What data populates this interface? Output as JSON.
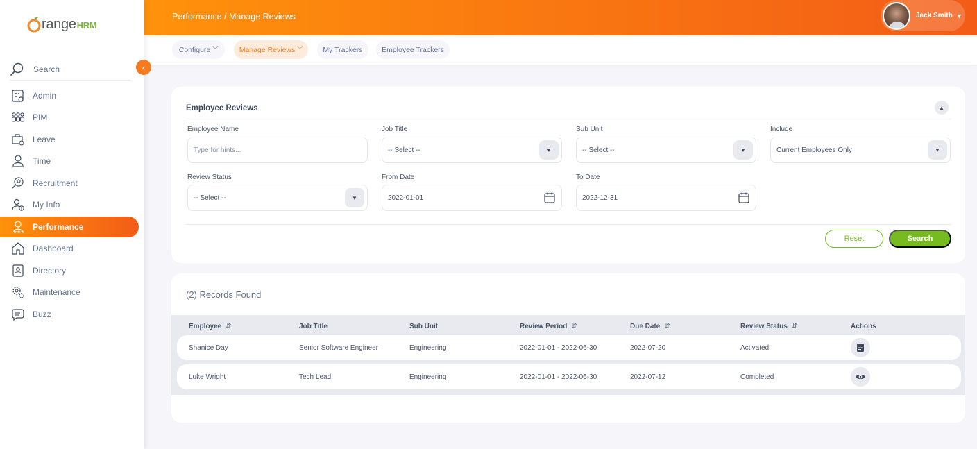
{
  "brand": {
    "o": "O",
    "rest": "range",
    "hrm": "HRM"
  },
  "sidebar": {
    "search_label": "Search",
    "items": [
      {
        "label": "Admin",
        "icon": "admin-icon"
      },
      {
        "label": "PIM",
        "icon": "pim-icon"
      },
      {
        "label": "Leave",
        "icon": "leave-icon"
      },
      {
        "label": "Time",
        "icon": "time-icon"
      },
      {
        "label": "Recruitment",
        "icon": "recruitment-icon"
      },
      {
        "label": "My Info",
        "icon": "my-info-icon"
      },
      {
        "label": "Performance",
        "icon": "performance-icon",
        "active": true
      },
      {
        "label": "Dashboard",
        "icon": "dashboard-icon"
      },
      {
        "label": "Directory",
        "icon": "directory-icon"
      },
      {
        "label": "Maintenance",
        "icon": "maintenance-icon"
      },
      {
        "label": "Buzz",
        "icon": "buzz-icon"
      }
    ]
  },
  "header": {
    "breadcrumb": "Performance / Manage Reviews",
    "user_name": "Jack Smith"
  },
  "subnav": {
    "configure": "Configure",
    "manage_reviews": "Manage Reviews",
    "my_trackers": "My Trackers",
    "employee_trackers": "Employee Trackers"
  },
  "filters": {
    "title": "Employee Reviews",
    "employee_name": {
      "label": "Employee Name",
      "placeholder": "Type for hints..."
    },
    "job_title": {
      "label": "Job Title",
      "value": "-- Select --"
    },
    "sub_unit": {
      "label": "Sub Unit",
      "value": "-- Select --"
    },
    "include": {
      "label": "Include",
      "value": "Current Employees Only"
    },
    "review_status": {
      "label": "Review Status",
      "value": "-- Select --"
    },
    "from_date": {
      "label": "From Date",
      "value": "2022-01-01"
    },
    "to_date": {
      "label": "To Date",
      "value": "2022-12-31"
    },
    "reset_label": "Reset",
    "search_label": "Search"
  },
  "results": {
    "records_found": "(2) Records Found",
    "columns": {
      "employee": "Employee",
      "job_title": "Job Title",
      "sub_unit": "Sub Unit",
      "review_period": "Review Period",
      "due_date": "Due Date",
      "review_status": "Review Status",
      "actions": "Actions"
    },
    "rows": [
      {
        "employee": "Shanice Day",
        "job_title": "Senior Software Engineer",
        "sub_unit": "Engineering",
        "review_period": "2022-01-01 - 2022-06-30",
        "due_date": "2022-07-20",
        "review_status": "Activated",
        "action_icon": "document-icon"
      },
      {
        "employee": "Luke Wright",
        "job_title": "Tech Lead",
        "sub_unit": "Engineering",
        "review_period": "2022-01-01 - 2022-06-30",
        "due_date": "2022-07-12",
        "review_status": "Completed",
        "action_icon": "eye-icon"
      }
    ]
  },
  "colors": {
    "accent": "#f47b20",
    "success": "#76bc21"
  }
}
